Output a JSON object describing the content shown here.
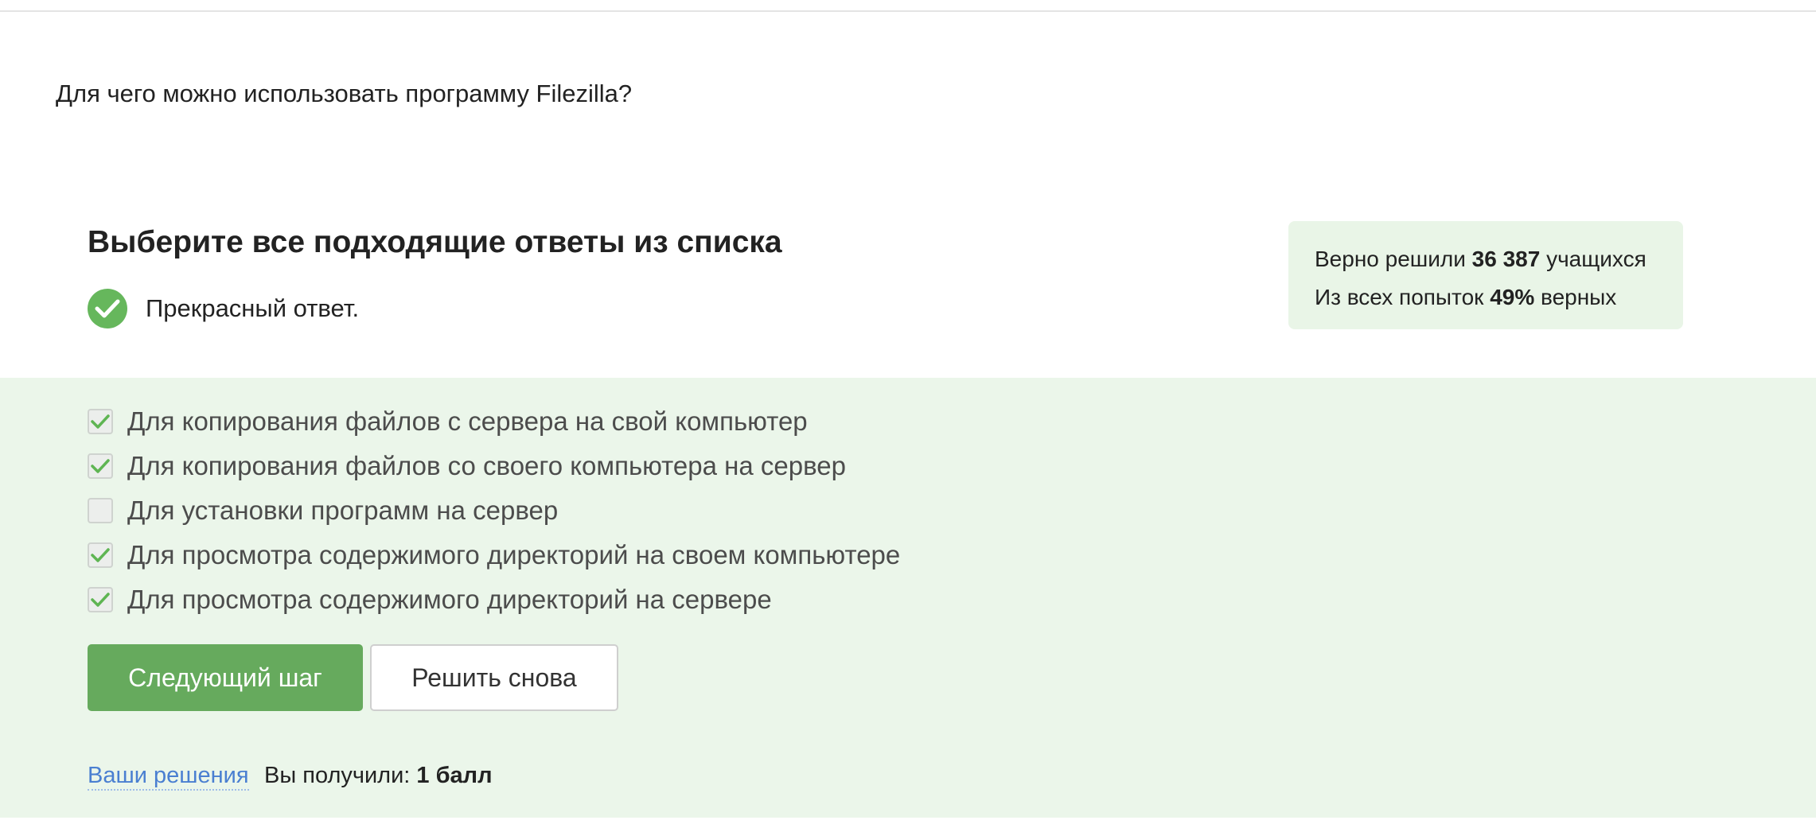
{
  "question": "Для чего можно использовать программу Filezilla?",
  "quiz": {
    "heading": "Выберите все подходящие ответы из списка",
    "feedback": "Прекрасный ответ."
  },
  "stats": {
    "solved_prefix": "Верно решили",
    "solved_count": "36 387",
    "solved_suffix": "учащихся",
    "attempts_prefix": "Из всех попыток",
    "attempts_percent": "49%",
    "attempts_suffix": "верных"
  },
  "options": [
    {
      "label": "Для копирования файлов с сервера на свой компьютер",
      "checked": true
    },
    {
      "label": "Для копирования файлов со своего компьютера на сервер",
      "checked": true
    },
    {
      "label": "Для установки программ на сервер",
      "checked": false
    },
    {
      "label": "Для просмотра содержимого директорий на своем компьютере",
      "checked": true
    },
    {
      "label": "Для просмотра содержимого директорий на сервере",
      "checked": true
    }
  ],
  "buttons": {
    "next": "Следующий шаг",
    "retry": "Решить снова"
  },
  "footer": {
    "solutions_link": "Ваши решения",
    "score_prefix": "Вы получили:",
    "score_value": "1 балл"
  },
  "colors": {
    "accent_green": "#66aa5d",
    "answer_bg": "#ebf6ea",
    "link_blue": "#4a7fd1"
  },
  "icons": {
    "feedback": "check-circle-icon",
    "option_checked": "checkmark-icon"
  }
}
